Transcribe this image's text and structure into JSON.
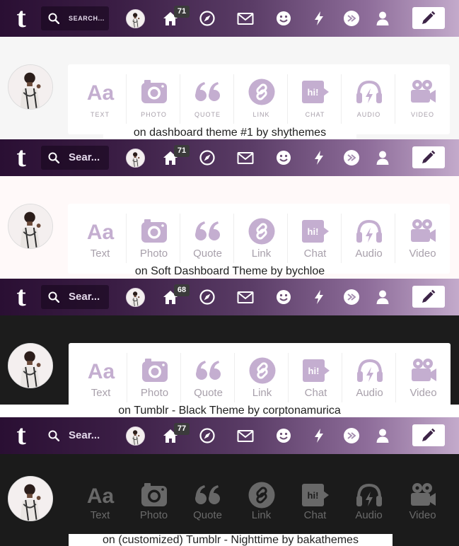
{
  "colors": {
    "accent": "#c4aed0",
    "nav_start": "#2a0f33",
    "nav_end": "#c3aacb",
    "panel1_bg": "#f6f6f6",
    "panel2_bg": "#fff9f9",
    "panel3_bg": "#1c1c1c",
    "panel4_bg": "#1b1b1b",
    "night_icon": "#686868",
    "night_label": "#6a6a6a"
  },
  "nav_icons": [
    "tumblr-logo",
    "search-icon",
    "user-avatar",
    "home-icon",
    "explore-compass-icon",
    "inbox-mail-icon",
    "smiley-icon",
    "activity-lightning-icon",
    "crossed-circle-icon",
    "account-person-icon",
    "compose-pencil-icon"
  ],
  "post_types_upper": [
    "TEXT",
    "PHOTO",
    "QUOTE",
    "LINK",
    "CHAT",
    "AUDIO",
    "VIDEO"
  ],
  "post_types": [
    "Text",
    "Photo",
    "Quote",
    "Link",
    "Chat",
    "Audio",
    "Video"
  ],
  "post_icons": [
    "text-aa-icon",
    "camera-icon",
    "quote-icon",
    "link-icon",
    "chat-icon",
    "headphones-icon",
    "video-camera-icon"
  ],
  "icon_glyphs": {
    "text": "Aa",
    "chat": "hi!"
  },
  "panels": [
    {
      "search_placeholder": "SEARCH...",
      "badge": "71",
      "caption": "on dashboard theme #1 by shythemes"
    },
    {
      "search_placeholder": "Sear...",
      "badge": "71",
      "caption": "on Soft Dashboard Theme by bychloe"
    },
    {
      "search_placeholder": "Sear...",
      "badge": "68",
      "caption": "on Tumblr - Black Theme by corptonamurica"
    },
    {
      "search_placeholder": "Sear...",
      "badge": "77",
      "caption": "on (customized) Tumblr - Nighttime  by bakathemes"
    }
  ]
}
